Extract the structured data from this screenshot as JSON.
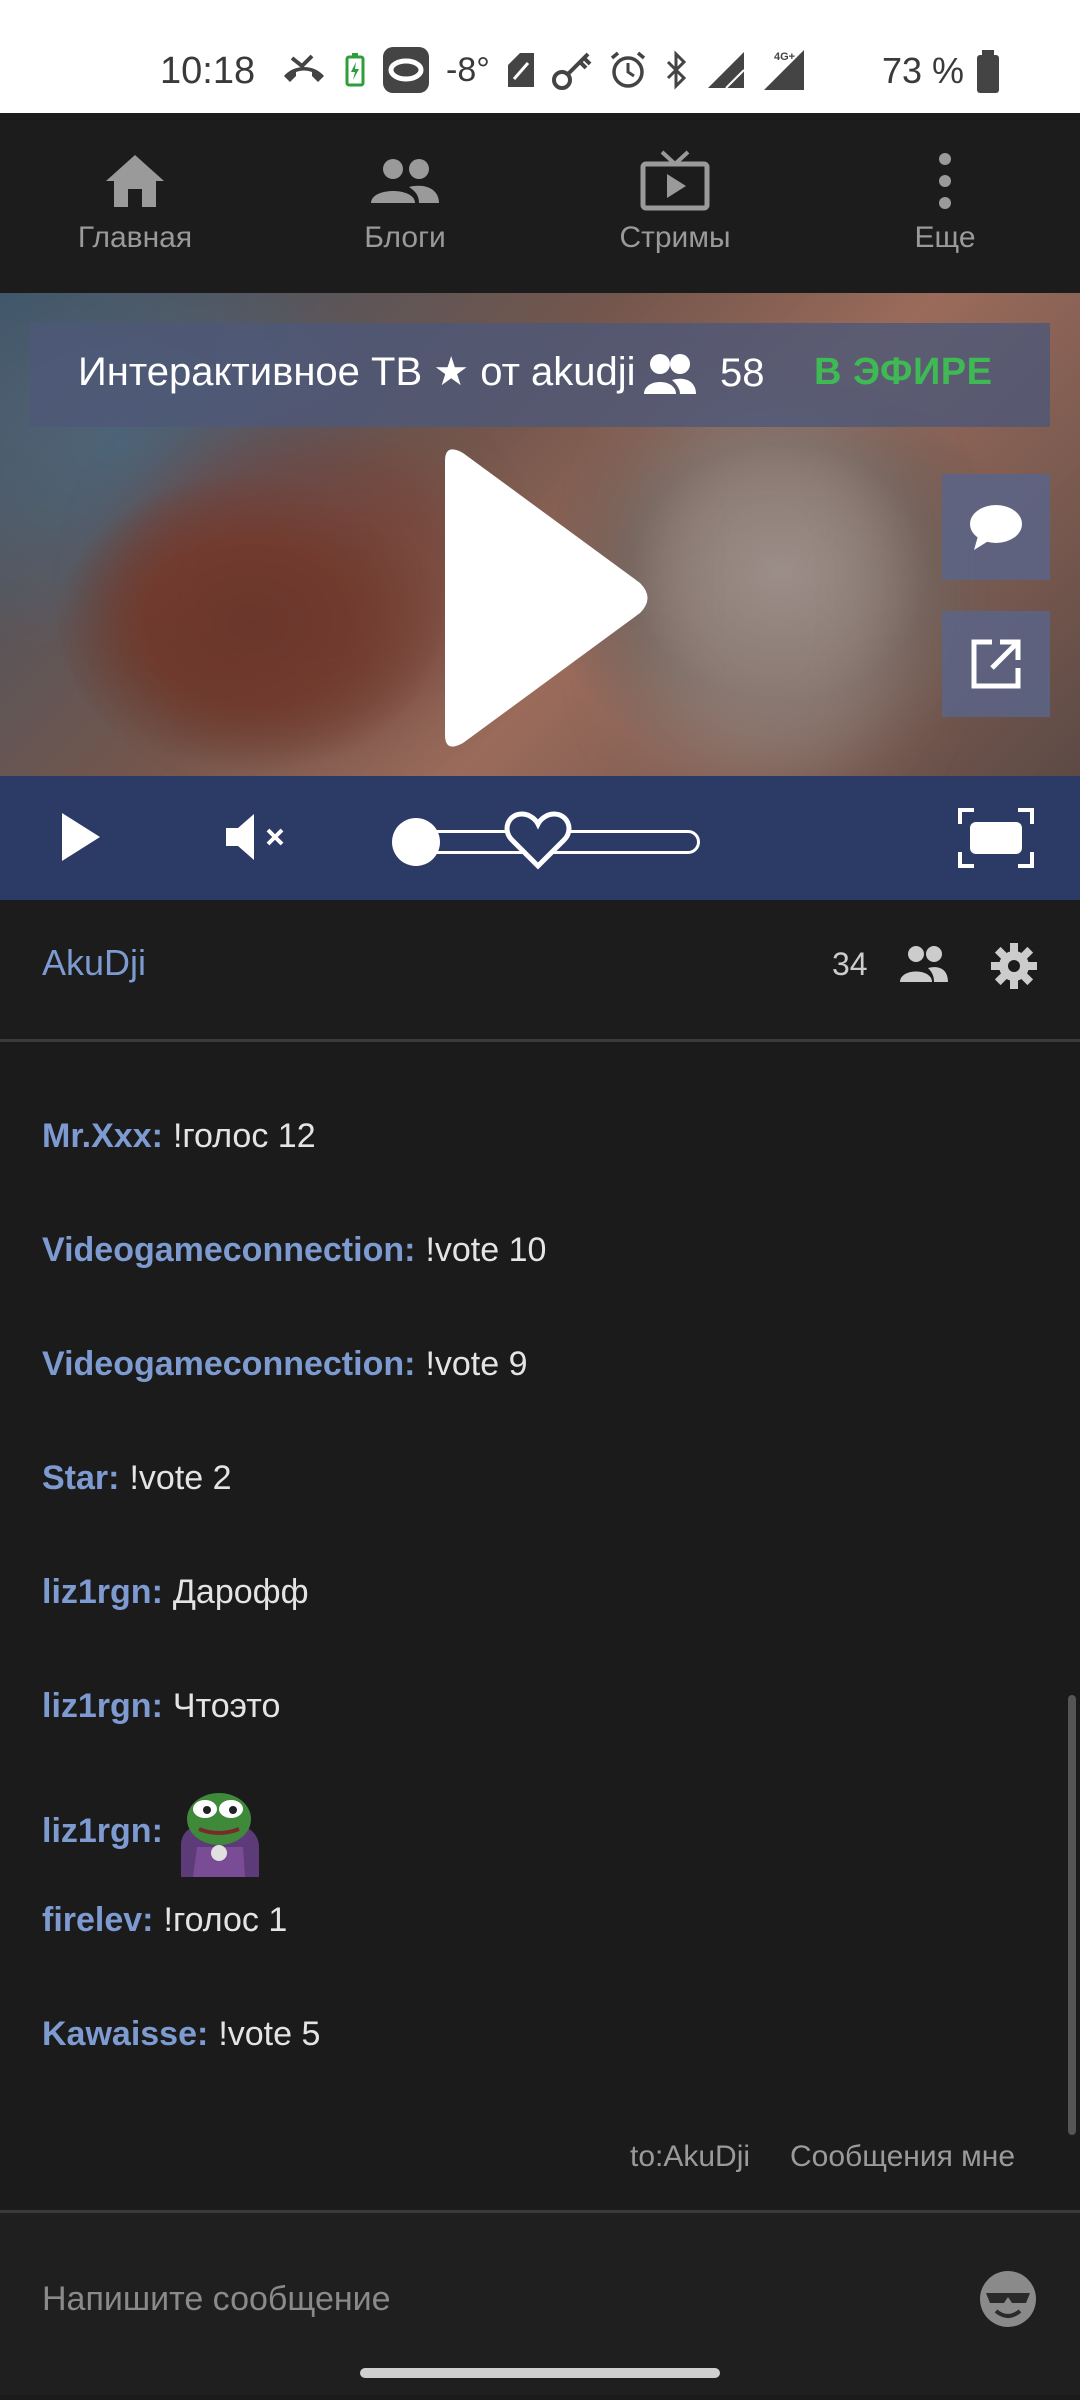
{
  "status_bar": {
    "time": "10:18",
    "temperature": "-8°",
    "battery_percent": "73 %",
    "network": "4G+"
  },
  "nav": {
    "items": [
      {
        "label": "Главная",
        "icon": "home-icon"
      },
      {
        "label": "Блоги",
        "icon": "people-icon"
      },
      {
        "label": "Стримы",
        "icon": "tv-icon"
      },
      {
        "label": "Еще",
        "icon": "more-vert-icon"
      }
    ]
  },
  "player": {
    "title": "Интерактивное ТВ ★ от akudji",
    "viewers": "58",
    "live_label": "В ЭФИРЕ",
    "volume_level": 0
  },
  "chat": {
    "owner": "AkuDji",
    "user_count": "34",
    "messages": [
      {
        "nick": "Mr.Xxx:",
        "text": "!голос 12"
      },
      {
        "nick": "Videogameconnection:",
        "text": "!vote 10"
      },
      {
        "nick": "Videogameconnection:",
        "text": "!vote 9"
      },
      {
        "nick": "Star:",
        "text": "!vote 2"
      },
      {
        "nick": "liz1rgn:",
        "text": "Дарофф"
      },
      {
        "nick": "liz1rgn:",
        "text": "Чтоэто"
      },
      {
        "nick": "liz1rgn:",
        "text": "",
        "emote": "pepe-emote"
      },
      {
        "nick": "firelev:",
        "text": "!голос 1"
      },
      {
        "nick": "Kawaisse:",
        "text": "!vote 5"
      }
    ],
    "link_to": "to:AkuDji",
    "link_mentions": "Сообщения мне",
    "input_placeholder": "Напишите сообщение"
  },
  "colors": {
    "nick": "#7d9bd1",
    "live": "#3fb954",
    "controls_bg": "#2c3a66",
    "bg": "#1b1b1c"
  }
}
